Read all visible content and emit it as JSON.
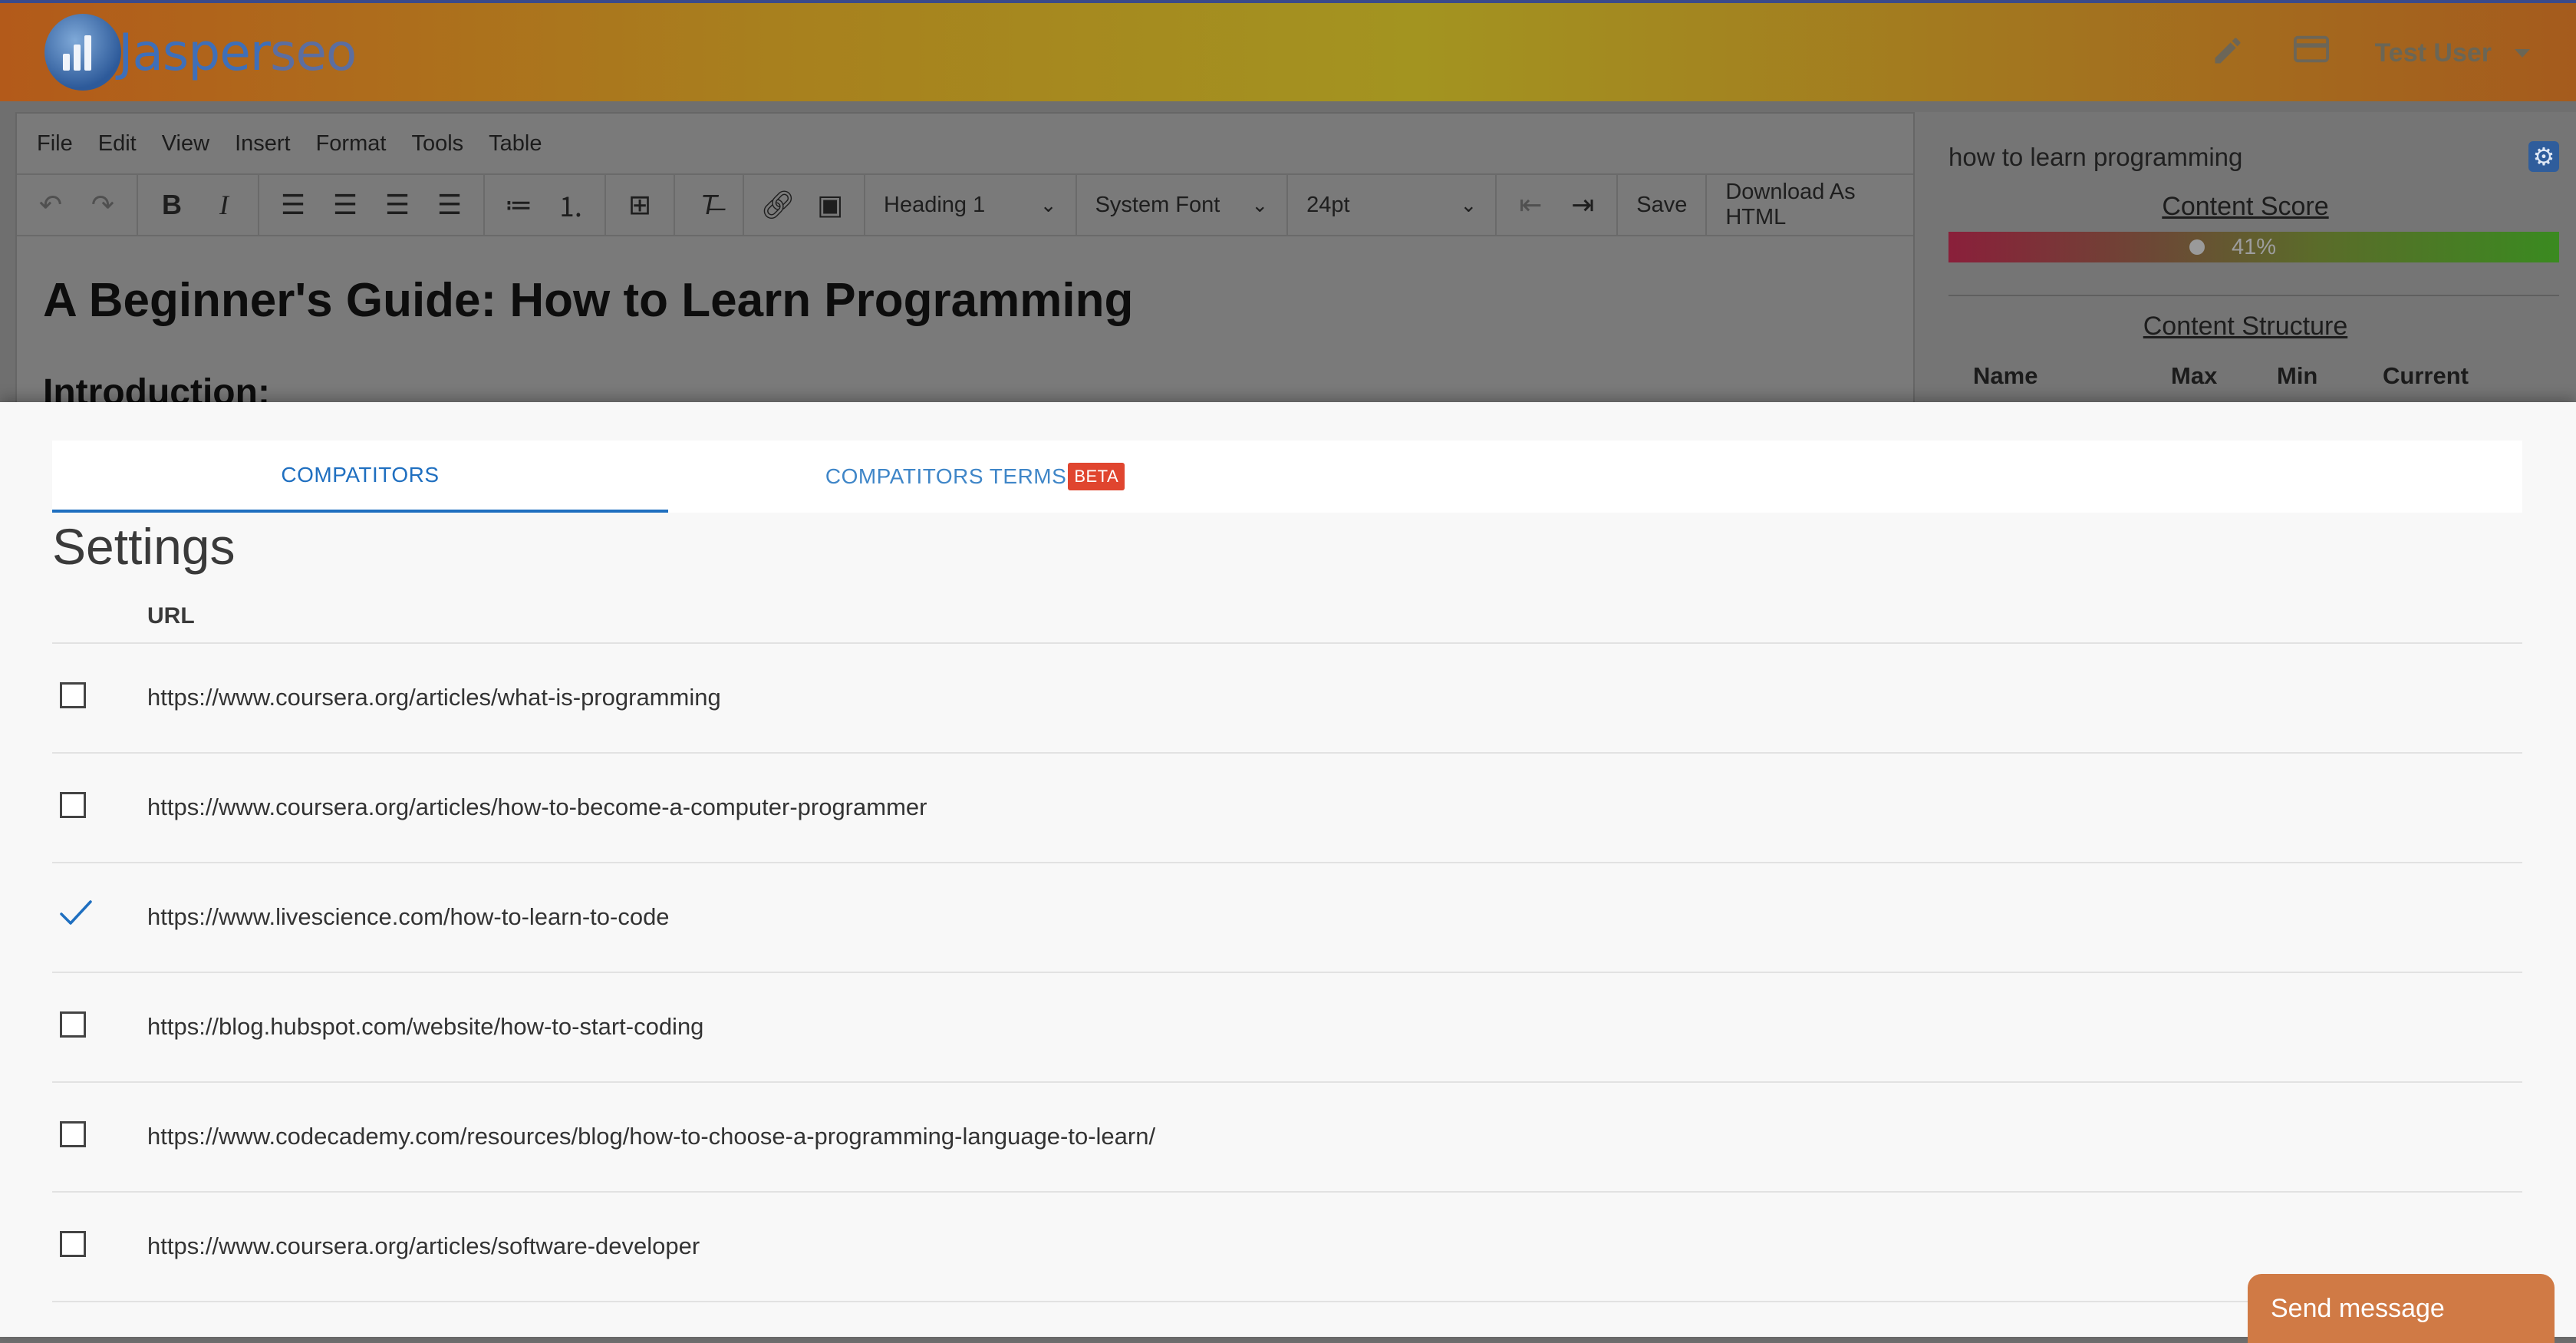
{
  "header": {
    "brand_part1": "Jasper",
    "brand_part2": "seo",
    "user_name": "Test User",
    "icons": [
      "pencil-icon",
      "card-icon",
      "caret-down-icon"
    ]
  },
  "editor": {
    "menu": [
      "File",
      "Edit",
      "View",
      "Insert",
      "Format",
      "Tools",
      "Table"
    ],
    "block_format": "Heading 1",
    "font_family": "System Font",
    "font_size": "24pt",
    "save_label": "Save",
    "download_label": "Download As HTML",
    "doc_title": "A Beginner's Guide: How to Learn Programming",
    "doc_subheading": "Introduction:"
  },
  "sidebar": {
    "keyword": "how to learn programming",
    "content_score_title": "Content Score",
    "content_score_value": "41%",
    "content_score_fraction": 0.41,
    "content_structure_title": "Content Structure",
    "columns": [
      "Name",
      "Max",
      "Min",
      "Current"
    ]
  },
  "panel": {
    "tabs": [
      {
        "label": "COMPATITORS",
        "active": true
      },
      {
        "label": "COMPATITORS TERMS",
        "badge": "BETA",
        "active": false
      }
    ],
    "title": "Settings",
    "column_header": "URL",
    "rows": [
      {
        "url": "https://www.coursera.org/articles/what-is-programming",
        "checked": false
      },
      {
        "url": "https://www.coursera.org/articles/how-to-become-a-computer-programmer",
        "checked": false
      },
      {
        "url": "https://www.livescience.com/how-to-learn-to-code",
        "checked": true
      },
      {
        "url": "https://blog.hubspot.com/website/how-to-start-coding",
        "checked": false
      },
      {
        "url": "https://www.codecademy.com/resources/blog/how-to-choose-a-programming-language-to-learn/",
        "checked": false
      },
      {
        "url": "https://www.coursera.org/articles/software-developer",
        "checked": false
      }
    ]
  },
  "chat": {
    "label": "Send message",
    "color": "#d07a45"
  },
  "colors": {
    "accent": "#1f6fc0",
    "beta_badge": "#e0452f"
  }
}
